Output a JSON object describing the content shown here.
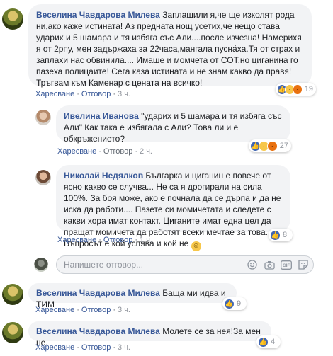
{
  "actions": {
    "like": "Харесване",
    "reply": "Отговор",
    "dot": "·"
  },
  "comments": [
    {
      "author": "Веселина Чавдарова Милева",
      "text": "Заплашили я,че ще изколят рода ни,ако каже истината! Аз предната нощ усетих,че нещо става ударих и 5 шамара и тя избяга със Али....после изчезна! Намерихя я от 2рпу, мен задържаха за 22часа,мангала пусна́ха.Тя от страх и заплахи нас обвинила.... Имаше и момчета от СОТ,но циганина го пазеха полицаите! Сега каза истината и не знам какво да правя! Тръгвам към Каменар с цената на всичко!",
      "time": "3 ч.",
      "reactions": [
        "like",
        "sad",
        "angry"
      ],
      "reaction_count": "19"
    },
    {
      "author": "Ивелина Иванова",
      "text": "\"ударих и 5 шамара и тя избяга със Али\" Как така е избягала с Али? Това ли и е обкръжението?",
      "time": "2 ч.",
      "reactions": [
        "like",
        "haha",
        "angry"
      ],
      "reaction_count": "27"
    },
    {
      "author": "Николай Недялков",
      "text": "Българка и циганин е повече от ясно какво се случва... Не са я дрогирали на сила 100%. За боя може, ако е почнала да се дърпа и да не иска да работи.... Пазете си момичетата и следете с какви хора имат контакт. Циганите имат една цел да пращат момичета да работят всеки мечтае за това... Въпросът е кой успява и кой не",
      "emoji": "smile-emoji",
      "time": "1 ч.",
      "reactions": [
        "like"
      ],
      "reaction_count": "8"
    },
    {
      "author": "Веселина Чавдарова Милева",
      "text": "Баща ми идва и ТИМ",
      "time": "3 ч.",
      "reactions": [
        "like"
      ],
      "reaction_count": "9"
    },
    {
      "author": "Веселина Чавдарова Милева",
      "text": "Молете се за нея!За мен не.",
      "time": "3 ч.",
      "reactions": [
        "like"
      ],
      "reaction_count": "4"
    }
  ],
  "reply_box": {
    "placeholder": "Напишете отговор...",
    "tools": [
      "emoji-icon",
      "camera-icon",
      "gif-icon",
      "sticker-icon"
    ]
  }
}
